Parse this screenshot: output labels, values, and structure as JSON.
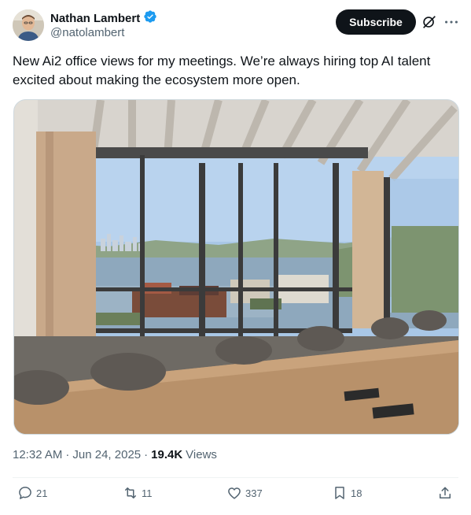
{
  "author": {
    "name": "Nathan Lambert",
    "handle": "@natolambert",
    "verified_color": "#1d9bf0"
  },
  "header": {
    "subscribe_label": "Subscribe",
    "grok_icon": "grok-icon",
    "more_icon": "more-icon"
  },
  "tweet": {
    "text": "New Ai2 office views for my meetings. We’re always hiring top AI talent excited about making the ecosystem more open.",
    "media_description_icon": "office-photo"
  },
  "meta": {
    "time": "12:32 AM",
    "separator": "·",
    "date": "Jun 24, 2025",
    "views_count": "19.4K",
    "views_label": "Views"
  },
  "actions": {
    "replies": "21",
    "reposts": "11",
    "likes": "337",
    "bookmarks": "18"
  },
  "colors": {
    "text": "#0f1419",
    "secondary": "#536471",
    "accent": "#1d9bf0",
    "button": "#0f1419"
  }
}
